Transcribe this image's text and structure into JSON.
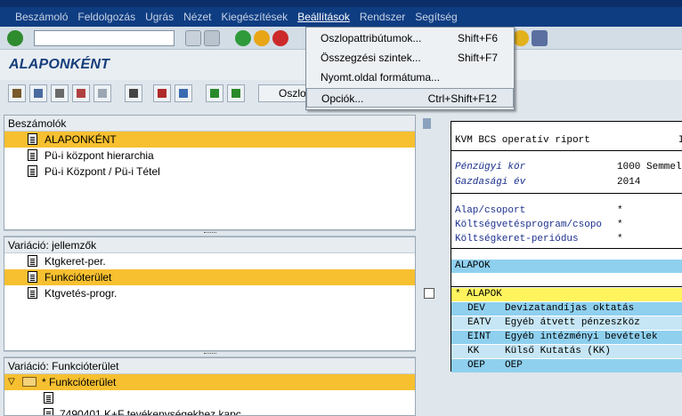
{
  "menubar": {
    "items": [
      "Beszámoló",
      "Feldolgozás",
      "Ugrás",
      "Nézet",
      "Kiegészítések",
      "Beállítások",
      "Rendszer",
      "Segítség"
    ],
    "active": "Beállítások"
  },
  "dropdown": {
    "items": [
      {
        "label": "Oszlopattribútumok...",
        "shortcut": "Shift+F6"
      },
      {
        "label": "Összegzési szintek...",
        "shortcut": "Shift+F7"
      },
      {
        "label": "Nyomt.oldal formátuma...",
        "shortcut": ""
      },
      {
        "label": "Opciók...",
        "shortcut": "Ctrl+Shift+F12"
      }
    ]
  },
  "app": {
    "title": "ALAPONKÉNT",
    "toolbar_button": "Oszlo"
  },
  "panels": {
    "reports": {
      "header": "Beszámolók",
      "items": [
        "ALAPONKÉNT",
        "Pü-i központ hierarchia",
        "Pü-i Központ / Pü-i Tétel"
      ]
    },
    "variation_char": {
      "header": "Variáció: jellemzők",
      "items": [
        "Ktgkeret-per.",
        "Funkcióterület",
        "Ktgvetés-progr."
      ]
    },
    "variation_func": {
      "header": "Variáció: Funkcióterület",
      "items": [
        "* Funkcióterület",
        "",
        "7490401 K+F tevékenységekhez kapc"
      ]
    }
  },
  "report": {
    "title": "KVM BCS operatív riport",
    "title_right": "I",
    "lines": [
      {
        "label": "Pénzügyi kör",
        "value": "1000 Semmel"
      },
      {
        "label": "Gazdasági év",
        "value": "2014"
      },
      {
        "label": "Alap/csoport",
        "value": "*"
      },
      {
        "label": "Költségvetésprogram/csopo",
        "value": "*"
      },
      {
        "label": "Költségkeret-periódus",
        "value": "*"
      }
    ],
    "band_alapok": "ALAPOK",
    "band_star": "* ALAPOK",
    "rows": [
      {
        "code": "DEV",
        "text": "Devizatandíjas oktatás"
      },
      {
        "code": "EATV",
        "text": "Egyéb átvett pénzeszköz"
      },
      {
        "code": "EINT",
        "text": "Egyéb intézményi bevételek"
      },
      {
        "code": "KK",
        "text": "Külső Kutatás (KK)"
      },
      {
        "code": "OEP",
        "text": "OEP"
      }
    ]
  },
  "colors": {
    "menubar": "#0f3d82",
    "selection": "#f7c030",
    "blue_band": "#8fd0ef",
    "yellow_band": "#fff45e"
  }
}
